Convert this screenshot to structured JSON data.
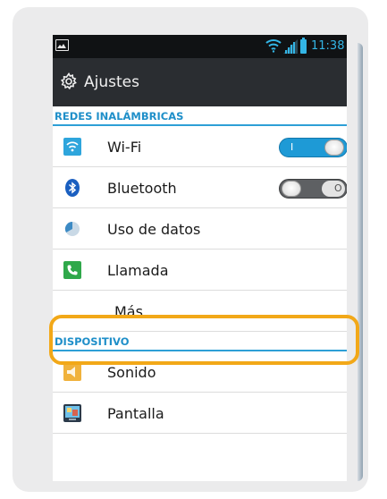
{
  "status_bar": {
    "time": "11:38"
  },
  "action_bar": {
    "title": "Ajustes",
    "icon": "gear-icon"
  },
  "sections": {
    "wireless": "REDES INALÁMBRICAS",
    "device": "DISPOSITIVO"
  },
  "items": {
    "wifi": {
      "label": "Wi-Fi",
      "icon": "wifi-icon",
      "toggle_on": true,
      "toggle_mark": "I"
    },
    "bluetooth": {
      "label": "Bluetooth",
      "icon": "bluetooth-icon",
      "toggle_on": false,
      "toggle_mark": "O"
    },
    "data_usage": {
      "label": "Uso de datos",
      "icon": "data-usage-icon"
    },
    "call": {
      "label": "Llamada",
      "icon": "phone-icon"
    },
    "more": {
      "label": "Más ..."
    },
    "sound": {
      "label": "Sonido",
      "icon": "speaker-icon"
    },
    "display": {
      "label": "Pantalla",
      "icon": "display-icon"
    }
  },
  "colors": {
    "accent": "#33b5e5",
    "highlight": "#f2a818",
    "section_text": "#1f8fc9"
  }
}
